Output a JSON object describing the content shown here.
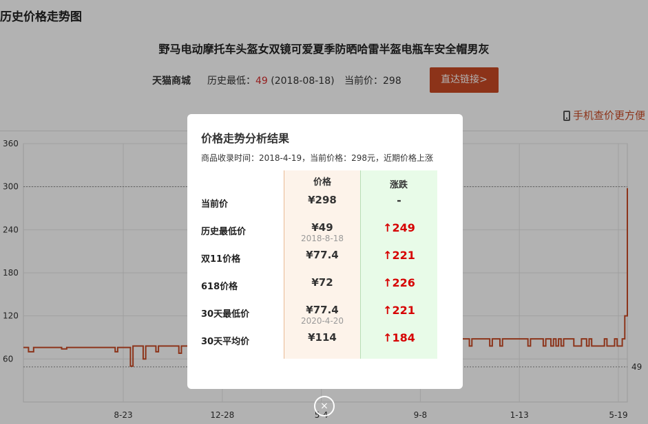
{
  "page": {
    "title": "历史价格走势图",
    "product_title": "野马电动摩托车头盔女双镜可爱夏季防晒哈雷半盔电瓶车安全帽男灰"
  },
  "info": {
    "shop": "天猫商城",
    "lowest_label": "历史最低：",
    "lowest_value": "49",
    "lowest_date": " (2018-08-18)",
    "current_label": "当前价：",
    "current_value": "298",
    "direct_button": "直达链接>",
    "mobile_link": "手机查价更方便"
  },
  "chart_data": {
    "type": "line",
    "x_tick_labels": [
      "8-23",
      "12-28",
      "5-4",
      "9-8",
      "1-13",
      "5-19"
    ],
    "y_ticks": [
      60,
      120,
      180,
      240,
      300,
      360
    ],
    "ylim": [
      0,
      360
    ],
    "reference_lines": [
      {
        "value": 300,
        "label": ""
      },
      {
        "value": 49,
        "label": "49"
      }
    ],
    "grid": true,
    "series": [
      {
        "color": "#c94a24",
        "values": [
          76,
          76,
          70,
          70,
          76,
          76,
          76,
          76,
          76,
          76,
          76,
          76,
          76,
          76,
          76,
          74,
          74,
          76,
          76,
          76,
          76,
          76,
          76,
          76,
          76,
          76,
          76,
          76,
          76,
          76,
          76,
          76,
          76,
          76,
          76,
          76,
          70,
          76,
          76,
          76,
          76,
          76,
          50,
          78,
          78,
          78,
          78,
          60,
          78,
          78,
          78,
          78,
          70,
          78,
          78,
          78,
          78,
          78,
          78,
          78,
          78,
          68,
          78,
          78,
          78,
          78,
          78,
          78,
          78,
          78,
          78,
          78,
          78,
          78,
          78,
          78,
          78,
          78,
          78,
          78,
          78,
          78,
          78,
          78,
          78,
          78,
          78,
          78,
          78,
          78,
          78,
          78,
          78,
          78,
          78,
          78,
          78,
          78,
          78,
          78,
          78,
          78,
          78,
          78,
          78,
          78,
          78,
          78,
          78,
          78,
          78,
          78,
          78,
          78,
          78,
          78,
          78,
          78,
          78,
          78,
          78,
          78,
          78,
          78,
          78,
          78,
          78,
          78,
          78,
          78,
          78,
          78,
          78,
          78,
          78,
          78,
          78,
          78,
          78,
          78,
          78,
          78,
          78,
          78,
          78,
          78,
          78,
          78,
          78,
          78,
          78,
          78,
          88,
          88,
          88,
          88,
          88,
          88,
          88,
          88,
          88,
          88,
          88,
          88,
          88,
          88,
          88,
          88,
          88,
          88,
          88,
          88,
          88,
          88,
          88,
          78,
          88,
          88,
          88,
          88,
          88,
          88,
          88,
          78,
          88,
          88,
          88,
          78,
          88,
          88,
          88,
          88,
          88,
          88,
          88,
          88,
          88,
          88,
          78,
          88,
          88,
          88,
          88,
          88,
          78,
          88,
          88,
          78,
          88,
          78,
          88,
          78,
          88,
          88,
          88,
          88,
          78,
          78,
          78,
          88,
          88,
          78,
          88,
          78,
          78,
          78,
          78,
          78,
          88,
          78,
          78,
          78,
          88,
          78,
          78,
          88,
          120,
          298
        ]
      }
    ]
  },
  "modal": {
    "title": "价格走势分析结果",
    "subtitle": "商品收录时间：2018-4-19，当前价格：298元，近期价格上涨",
    "col_price": "价格",
    "col_change": "涨跌",
    "rows": [
      {
        "label": "当前价",
        "price": "¥298",
        "date": "",
        "change": "-"
      },
      {
        "label": "历史最低价",
        "price": "¥49",
        "date": "2018-8-18",
        "change": "↑249"
      },
      {
        "label": "双11价格",
        "price": "¥77.4",
        "date": "",
        "change": "↑221"
      },
      {
        "label": "618价格",
        "price": "¥72",
        "date": "",
        "change": "↑226"
      },
      {
        "label": "30天最低价",
        "price": "¥77.4",
        "date": "2020-4-20",
        "change": "↑221"
      },
      {
        "label": "30天平均价",
        "price": "¥114",
        "date": "",
        "change": "↑184"
      }
    ],
    "close": "×"
  },
  "colors": {
    "accent": "#c94a24",
    "rise": "#d60000",
    "price_col_bg": "#fdf3ea",
    "change_col_bg": "#e8fbe8"
  }
}
